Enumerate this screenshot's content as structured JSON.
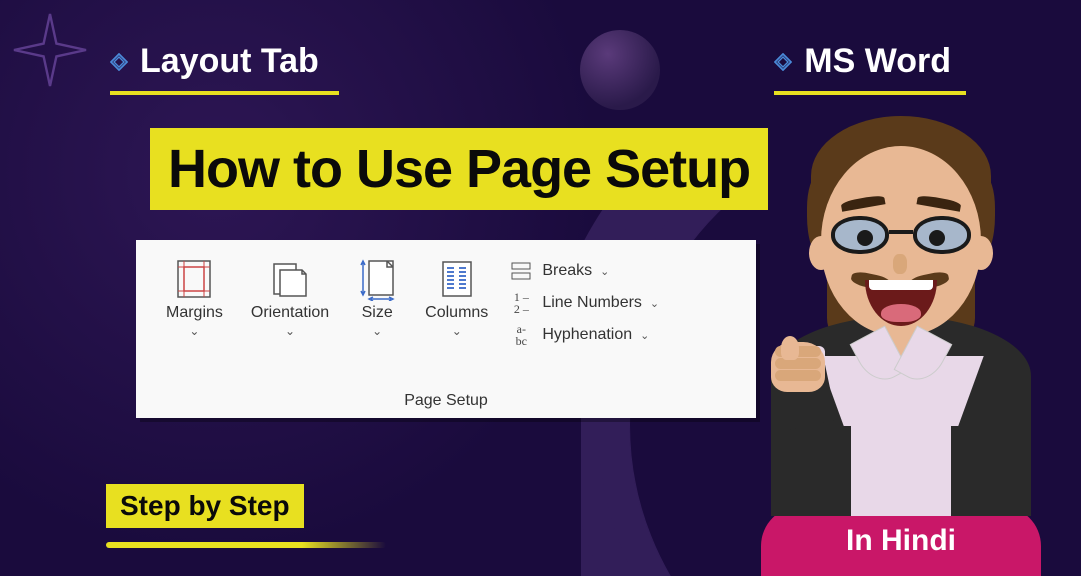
{
  "tags": {
    "left": "Layout Tab",
    "right": "MS Word"
  },
  "hero_title": "How to Use Page Setup",
  "ribbon": {
    "group_label": "Page Setup",
    "buttons": {
      "margins": "Margins",
      "orientation": "Orientation",
      "size": "Size",
      "columns": "Columns"
    },
    "side": {
      "breaks": "Breaks",
      "line_numbers": "Line Numbers",
      "hyphenation": "Hyphenation"
    }
  },
  "step_badge": "Step by Step",
  "hindi_badge": "In Hindi"
}
